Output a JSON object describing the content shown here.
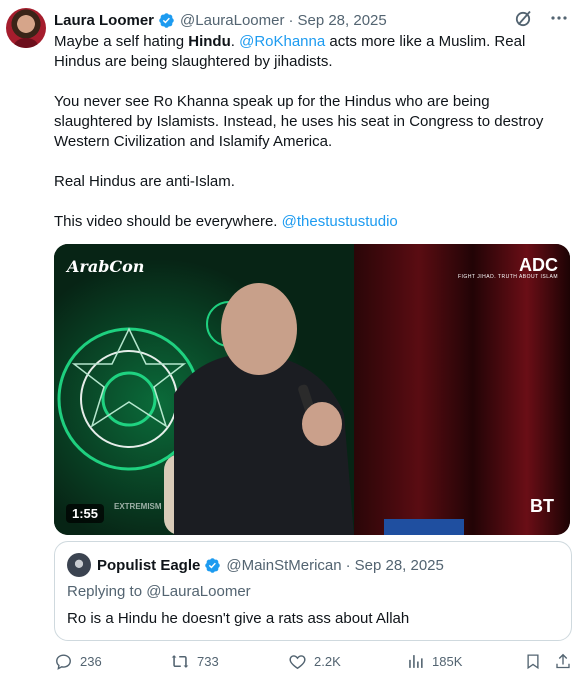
{
  "author": {
    "name": "Laura Loomer",
    "handle": "@LauraLoomer",
    "date": "Sep 28, 2025"
  },
  "tweet": {
    "p1_a": "Maybe a self hating ",
    "p1_bold": "Hindu",
    "p1_b": ". ",
    "p1_mention": "@RoKhanna",
    "p1_c": " acts more like a Muslim. Real Hindus are being slaughtered by jihadists.",
    "p2": "You never see Ro Khanna speak up for the Hindus who are being slaughtered by Islamists. Instead, he uses his seat in Congress to destroy Western Civilization and Islamify America.",
    "p3": "Real Hindus are anti-Islam.",
    "p4_a": "This video should be everywhere. ",
    "p4_mention": "@thestustustudio"
  },
  "video": {
    "duration": "1:55",
    "logo_left": "ArabCon",
    "logo_right": "ADC",
    "logo_right_sub": "FIGHT JIHAD. TRUTH ABOUT ISLAM",
    "corner_logo": "BT",
    "watermark": "EXTREMISM"
  },
  "quote": {
    "name": "Populist Eagle",
    "handle": "@MainStMerican",
    "date": "Sep 28, 2025",
    "replying_to": "Replying to @LauraLoomer",
    "text": "Ro is a Hindu he doesn't give a rats ass about Allah"
  },
  "metrics": {
    "replies": "236",
    "reposts": "733",
    "likes": "2.2K",
    "views": "185K"
  },
  "colors": {
    "accent": "#1d9bf0",
    "secondary_text": "#536471",
    "border": "#cfd9de"
  },
  "icons": [
    "grok-icon",
    "more-icon",
    "verified-badge-icon",
    "reply-icon",
    "repost-icon",
    "like-icon",
    "views-icon",
    "bookmark-icon",
    "share-icon"
  ]
}
